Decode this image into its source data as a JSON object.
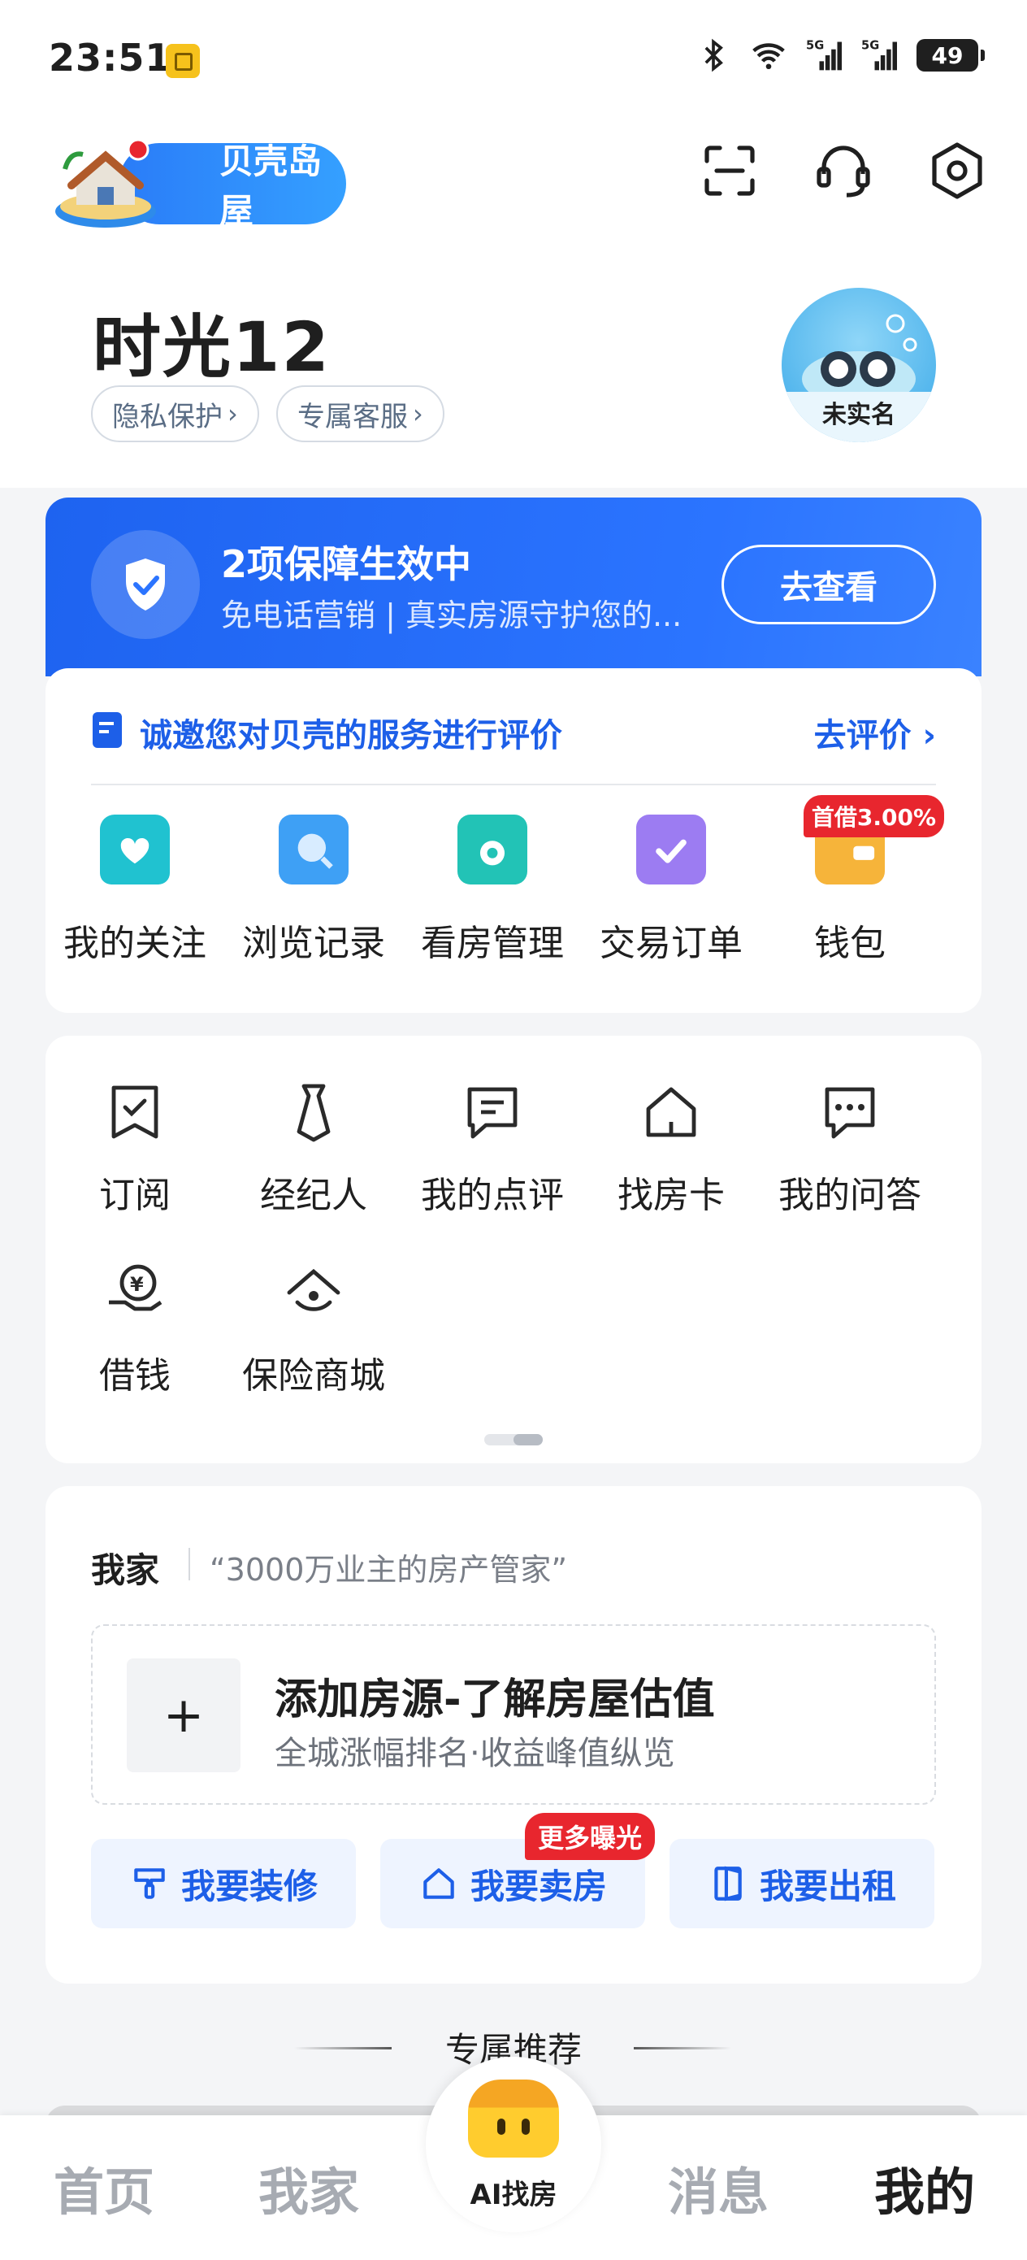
{
  "status_bar": {
    "time": "23:51",
    "network_1": "5G",
    "network_2": "5G",
    "battery": "49"
  },
  "header": {
    "logo_text": "贝壳岛屋",
    "icons": [
      "scan-icon",
      "customer-service-icon",
      "settings-icon"
    ]
  },
  "user": {
    "name": "时光12",
    "chips": [
      "隐私保护",
      "专属客服"
    ],
    "avatar_label": "未实名"
  },
  "banner": {
    "title": "2项保障生效中",
    "subtitle": "免电话营销 | 真实房源守护您的...",
    "button": "去查看"
  },
  "rating": {
    "text": "诚邀您对贝壳的服务进行评价",
    "link": "去评价"
  },
  "main_grid": [
    {
      "label": "我的关注",
      "icon": "heart-house-icon",
      "color": "#20c2d0"
    },
    {
      "label": "浏览记录",
      "icon": "search-doc-icon",
      "color": "#3ea0f5"
    },
    {
      "label": "看房管理",
      "icon": "folder-eye-icon",
      "color": "#22c3b6"
    },
    {
      "label": "交易订单",
      "icon": "clipboard-check-icon",
      "color": "#9c7cf2"
    },
    {
      "label": "钱包",
      "icon": "wallet-icon",
      "color": "#f6b43a",
      "badge": "首借3.00%"
    }
  ],
  "services": {
    "row1": [
      {
        "label": "订阅",
        "icon": "subscribe-icon"
      },
      {
        "label": "经纪人",
        "icon": "agent-icon"
      },
      {
        "label": "我的点评",
        "icon": "review-icon"
      },
      {
        "label": "找房卡",
        "icon": "house-card-icon"
      },
      {
        "label": "我的问答",
        "icon": "qa-icon"
      }
    ],
    "row2": [
      {
        "label": "借钱",
        "icon": "loan-icon"
      },
      {
        "label": "保险商城",
        "icon": "insurance-icon"
      }
    ]
  },
  "my_home": {
    "title": "我家",
    "subtitle": "“3000万业主的房产管家”",
    "add_title": "添加房源-了解房屋估值",
    "add_sub": "全城涨幅排名·收益峰值纵览",
    "actions": [
      {
        "label": "我要装修",
        "icon": "paint-icon"
      },
      {
        "label": "我要卖房",
        "icon": "house-sell-icon",
        "badge": "更多曝光"
      },
      {
        "label": "我要出租",
        "icon": "door-icon"
      }
    ]
  },
  "recommend": {
    "title": "专属推荐"
  },
  "bottom_nav": {
    "items": [
      "首页",
      "我家",
      "消息",
      "我的"
    ],
    "ai_label": "AI找房"
  }
}
